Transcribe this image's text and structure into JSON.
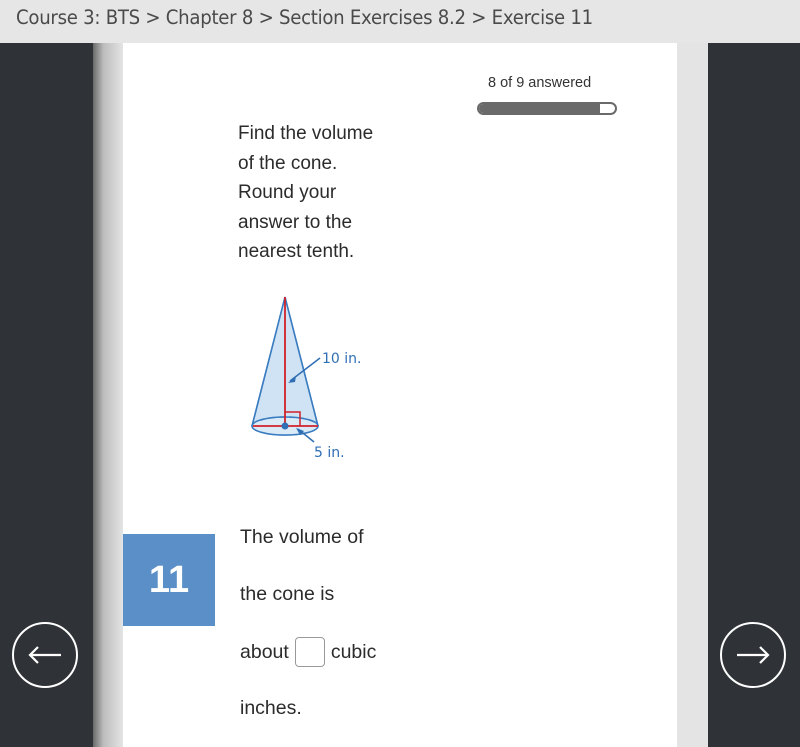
{
  "breadcrumb": {
    "text": "Course 3: BTS > Chapter 8 > Section Exercises 8.2 > Exercise 11",
    "items": [
      "Course 3: BTS",
      "Chapter 8",
      "Section Exercises 8.2",
      "Exercise 11"
    ]
  },
  "progress": {
    "label": "8 of 9 answered",
    "answered": 8,
    "total": 9,
    "fraction": 0.889
  },
  "question": {
    "prompt_lines": [
      "Find the volume",
      "of the cone.",
      "Round your",
      "answer to the",
      "nearest tenth."
    ],
    "figure": {
      "shape": "cone",
      "slant_label": "10 in.",
      "radius_label": "5 in.",
      "fill_color": "#cfe3f4",
      "outline_color": "#3a7cc0",
      "measure_color": "#d0202a",
      "label_color": "#2f6fb5"
    },
    "number": "11",
    "badge_color": "#5b8fc7",
    "answer": {
      "line1": "The volume of",
      "line2": "the cone is",
      "before_input": "about",
      "after_input": "cubic",
      "line4": "inches.",
      "input_value": ""
    }
  },
  "nav": {
    "prev_icon": "arrow-left-icon",
    "next_icon": "arrow-right-icon"
  }
}
